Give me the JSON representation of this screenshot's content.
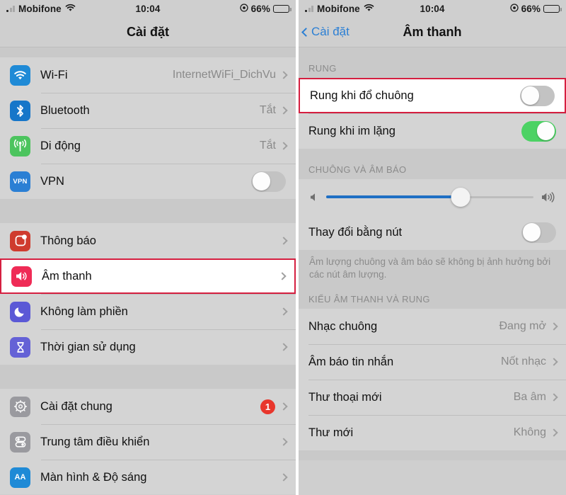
{
  "statusbar": {
    "carrier": "Mobifone",
    "time": "10:04",
    "battery_percent": "66%",
    "signal_icon": "cellular-signal-icon",
    "wifi_icon": "wifi-icon",
    "location_icon": "location-services-icon",
    "battery_icon": "battery-icon"
  },
  "left": {
    "nav": {
      "title": "Cài đặt"
    },
    "groups": [
      {
        "rows": [
          {
            "label": "Wi-Fi",
            "value": "InternetWiFi_DichVu",
            "accessory": "chevron",
            "icon": "wifi-icon",
            "icon_color": "#1f8ad6",
            "name": "settings-row-wifi"
          },
          {
            "label": "Bluetooth",
            "value": "Tắt",
            "accessory": "chevron",
            "icon": "bluetooth-icon",
            "icon_color": "#1676c9",
            "name": "settings-row-bluetooth"
          },
          {
            "label": "Di động",
            "value": "Tắt",
            "accessory": "chevron",
            "icon": "cellular-icon",
            "icon_color": "#4cc45e",
            "name": "settings-row-cellular"
          },
          {
            "label": "VPN",
            "value": "",
            "accessory": "toggle-off",
            "icon": "vpn-icon",
            "icon_color": "#2b7fd4",
            "name": "settings-row-vpn"
          }
        ]
      },
      {
        "rows": [
          {
            "label": "Thông báo",
            "value": "",
            "accessory": "chevron",
            "icon": "notifications-icon",
            "icon_color": "#cf3b2e",
            "name": "settings-row-notifications"
          },
          {
            "label": "Âm thanh",
            "value": "",
            "accessory": "chevron",
            "icon": "sounds-icon",
            "icon_color": "#ef2b56",
            "name": "settings-row-sounds",
            "highlighted": true
          },
          {
            "label": "Không làm phiền",
            "value": "",
            "accessory": "chevron",
            "icon": "moon-icon",
            "icon_color": "#5b59d6",
            "name": "settings-row-do-not-disturb"
          },
          {
            "label": "Thời gian sử dụng",
            "value": "",
            "accessory": "chevron",
            "icon": "hourglass-icon",
            "icon_color": "#6461d6",
            "name": "settings-row-screen-time"
          }
        ]
      },
      {
        "rows": [
          {
            "label": "Cài đặt chung",
            "value": "",
            "badge": "1",
            "accessory": "chevron",
            "icon": "gear-icon",
            "icon_color": "#9a9a9f",
            "name": "settings-row-general"
          },
          {
            "label": "Trung tâm điều khiển",
            "value": "",
            "accessory": "chevron",
            "icon": "control-center-icon",
            "icon_color": "#9a9a9f",
            "name": "settings-row-control-center"
          },
          {
            "label": "Màn hình & Độ sáng",
            "value": "",
            "accessory": "chevron",
            "icon": "display-brightness-icon",
            "icon_color": "#1f8ad6",
            "name": "settings-row-display-brightness"
          }
        ]
      }
    ]
  },
  "right": {
    "nav": {
      "back_label": "Cài đặt",
      "title": "Âm thanh"
    },
    "section_vibrate": {
      "header": "RUNG",
      "rows": [
        {
          "label": "Rung khi đổ chuông",
          "state": "off",
          "name": "toggle-row-vibrate-on-ring",
          "highlighted": true
        },
        {
          "label": "Rung khi im lặng",
          "state": "on",
          "name": "toggle-row-vibrate-on-silent"
        }
      ]
    },
    "section_ringer": {
      "header": "CHUÔNG VÀ ÂM BÁO",
      "slider": {
        "name": "ringer-volume-slider",
        "value_percent": 65,
        "left_icon": "speaker-low-icon",
        "right_icon": "speaker-high-icon"
      },
      "toggle_row": {
        "label": "Thay đổi bằng nút",
        "state": "off",
        "name": "toggle-row-change-with-buttons"
      },
      "footer": "Âm lượng chuông và âm báo sẽ không bị ảnh hưởng bởi các nút âm lượng."
    },
    "section_sounds": {
      "header": "KIỂU ÂM THANH VÀ RUNG",
      "rows": [
        {
          "label": "Nhạc chuông",
          "value": "Đang mở",
          "name": "sound-row-ringtone"
        },
        {
          "label": "Âm báo tin nhắn",
          "value": "Nốt nhạc",
          "name": "sound-row-text-tone"
        },
        {
          "label": "Thư thoại mới",
          "value": "Ba âm",
          "name": "sound-row-new-voicemail"
        },
        {
          "label": "Thư mới",
          "value": "Không",
          "name": "sound-row-new-mail"
        }
      ]
    }
  },
  "colors": {
    "highlight_border": "#d51f40",
    "toggle_on": "#4cd264",
    "slider_fill": "#1f6fc4",
    "badge": "#e8362c",
    "link": "#2b7fd4"
  }
}
